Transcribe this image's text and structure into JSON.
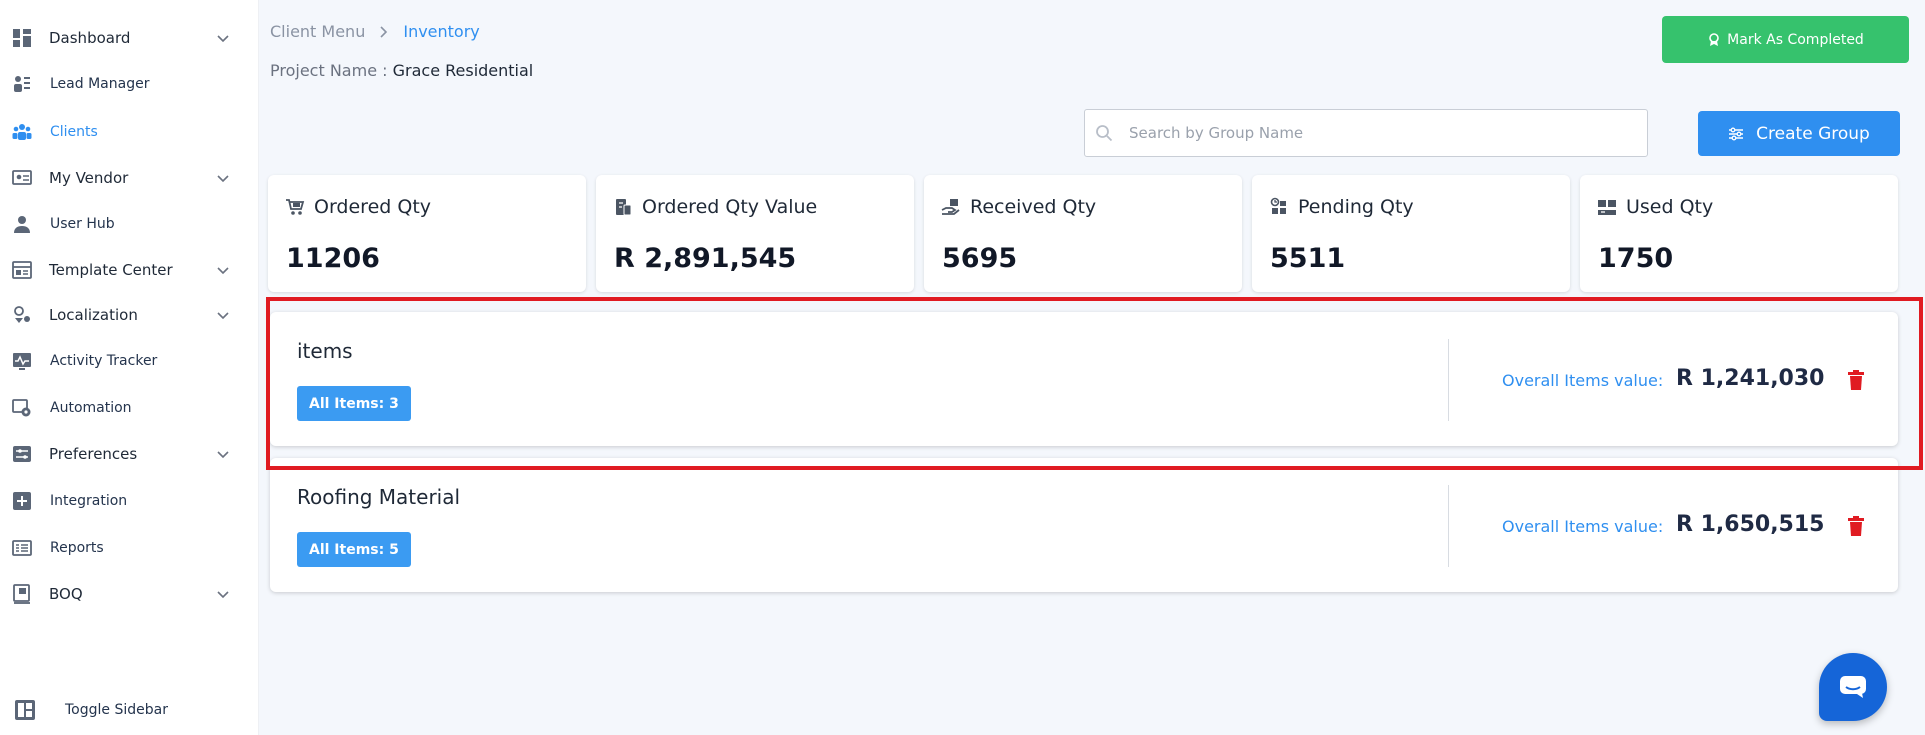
{
  "sidebar": {
    "items": [
      {
        "label": "Dashboard",
        "icon": "dashboard-icon",
        "has_chevron": true
      },
      {
        "label": "Lead Manager",
        "icon": "lead-manager-icon",
        "has_chevron": false
      },
      {
        "label": "Clients",
        "icon": "clients-icon",
        "has_chevron": false,
        "active": true
      },
      {
        "label": "My Vendor",
        "icon": "vendor-icon",
        "has_chevron": true
      },
      {
        "label": "User Hub",
        "icon": "user-icon",
        "has_chevron": false
      },
      {
        "label": "Template Center",
        "icon": "template-icon",
        "has_chevron": true
      },
      {
        "label": "Localization",
        "icon": "localization-icon",
        "has_chevron": true
      },
      {
        "label": "Activity Tracker",
        "icon": "activity-icon",
        "has_chevron": false
      },
      {
        "label": "Automation",
        "icon": "automation-icon",
        "has_chevron": false
      },
      {
        "label": "Preferences",
        "icon": "preferences-icon",
        "has_chevron": true
      },
      {
        "label": "Integration",
        "icon": "integration-icon",
        "has_chevron": false
      },
      {
        "label": "Reports",
        "icon": "reports-icon",
        "has_chevron": false
      },
      {
        "label": "BOQ",
        "icon": "boq-icon",
        "has_chevron": true
      }
    ],
    "toggle_label": "Toggle Sidebar"
  },
  "breadcrumb": {
    "parent": "Client Menu",
    "current": "Inventory"
  },
  "project": {
    "label": "Project Name :",
    "name": "Grace Residential"
  },
  "actions": {
    "mark_completed": "Mark As Completed",
    "create_group": "Create Group"
  },
  "search": {
    "placeholder": "Search by Group Name",
    "value": ""
  },
  "stats": [
    {
      "label": "Ordered Qty",
      "value": "11206",
      "icon": "cart-icon"
    },
    {
      "label": "Ordered Qty Value",
      "value": "R 2,891,545",
      "icon": "money-icon"
    },
    {
      "label": "Received Qty",
      "value": "5695",
      "icon": "hand-box-icon"
    },
    {
      "label": "Pending Qty",
      "value": "5511",
      "icon": "pending-icon"
    },
    {
      "label": "Used Qty",
      "value": "1750",
      "icon": "used-icon"
    }
  ],
  "groups": [
    {
      "name": "items",
      "badge": "All Items: 3",
      "value_label": "Overall Items value:",
      "value": "R 1,241,030"
    },
    {
      "name": "Roofing Material",
      "badge": "All Items: 5",
      "value_label": "Overall Items value:",
      "value": "R 1,650,515"
    }
  ],
  "colors": {
    "accent": "#2f8ff0",
    "success": "#36c26d",
    "danger": "#e01b22",
    "background": "#f4f7fc"
  }
}
